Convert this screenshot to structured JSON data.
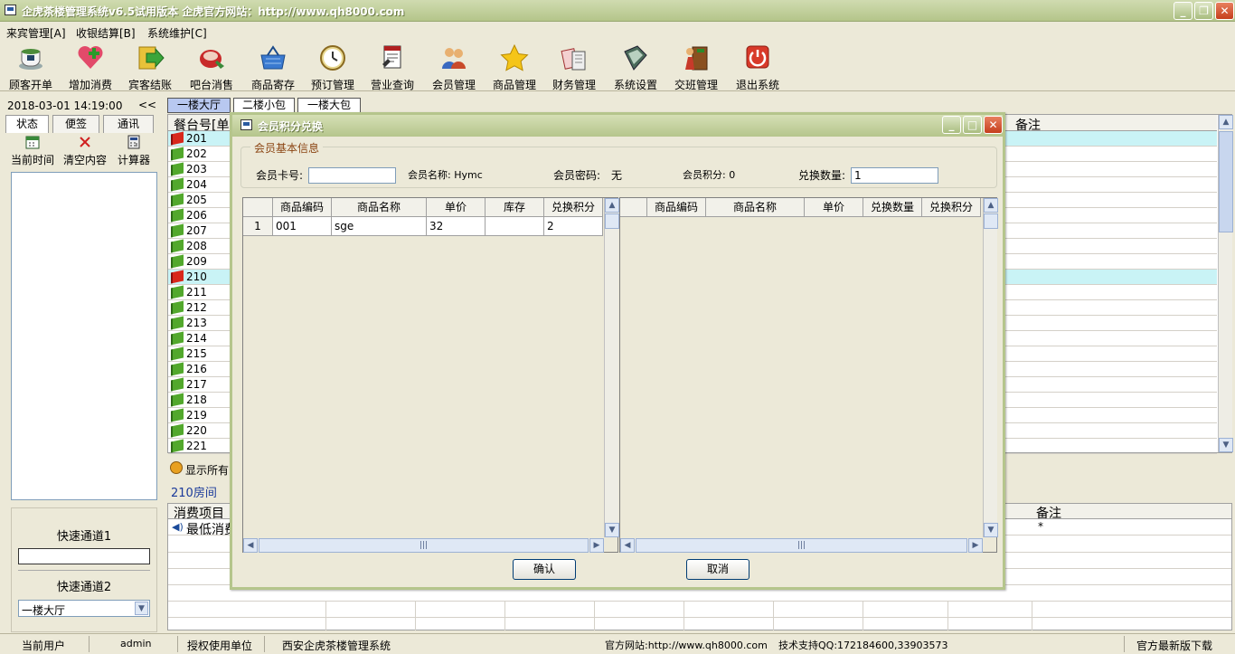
{
  "app": {
    "title": "企虎茶楼管理系统v6.5试用版本 企虎官方网站：http://www.qh8000.com"
  },
  "menu": [
    "来宾管理[A]",
    "收银结算[B]",
    "系统维护[C]"
  ],
  "toolbar": [
    {
      "label": "顾客开单",
      "icon": "teacup-icon"
    },
    {
      "label": "增加消费",
      "icon": "add-consumption-icon"
    },
    {
      "label": "宾客结账",
      "icon": "checkout-arrow-icon"
    },
    {
      "label": "吧台消售",
      "icon": "bar-sales-icon"
    },
    {
      "label": "商品寄存",
      "icon": "basket-icon"
    },
    {
      "label": "预订管理",
      "icon": "clock-icon"
    },
    {
      "label": "营业查询",
      "icon": "query-icon"
    },
    {
      "label": "会员管理",
      "icon": "members-icon"
    },
    {
      "label": "商品管理",
      "icon": "star-icon"
    },
    {
      "label": "财务管理",
      "icon": "finance-icon"
    },
    {
      "label": "系统设置",
      "icon": "settings-icon"
    },
    {
      "label": "交班管理",
      "icon": "shift-exit-icon"
    },
    {
      "label": "退出系统",
      "icon": "power-icon"
    }
  ],
  "sidebar": {
    "datetime": "2018-03-01  14:19:00",
    "collapse": "<<",
    "tabs": [
      "状态",
      "便签",
      "通讯"
    ],
    "tools": [
      "当前时间",
      "清空内容",
      "计算器"
    ],
    "quick1_label": "快速通道1",
    "quick2_label": "快速通道2",
    "quick2_value": "一楼大厅"
  },
  "room_tabs": [
    "一楼大厅",
    "二楼小包",
    "一楼大包"
  ],
  "room_grid": {
    "col_header": "餐台号[单",
    "note_header": "备注",
    "rows": [
      {
        "num": "201",
        "status": "red"
      },
      {
        "num": "202",
        "status": "green"
      },
      {
        "num": "203",
        "status": "green"
      },
      {
        "num": "204",
        "status": "green"
      },
      {
        "num": "205",
        "status": "green"
      },
      {
        "num": "206",
        "status": "green"
      },
      {
        "num": "207",
        "status": "green"
      },
      {
        "num": "208",
        "status": "green"
      },
      {
        "num": "209",
        "status": "green"
      },
      {
        "num": "210",
        "status": "red"
      },
      {
        "num": "211",
        "status": "green"
      },
      {
        "num": "212",
        "status": "green"
      },
      {
        "num": "213",
        "status": "green"
      },
      {
        "num": "214",
        "status": "green"
      },
      {
        "num": "215",
        "status": "green"
      },
      {
        "num": "216",
        "status": "green"
      },
      {
        "num": "217",
        "status": "green"
      },
      {
        "num": "218",
        "status": "green"
      },
      {
        "num": "219",
        "status": "green"
      },
      {
        "num": "220",
        "status": "green"
      },
      {
        "num": "221",
        "status": "green"
      }
    ]
  },
  "show_all_label": "显示所有",
  "room_label": "210房间",
  "consumption": {
    "header": "消费项目",
    "note_header": "备注",
    "row_item": "最低消费",
    "row_note": "*"
  },
  "dialog": {
    "title": "会员积分兑换",
    "section": "会员基本信息",
    "card_label": "会员卡号:",
    "card_value": "",
    "name_label": "会员名称: Hymc",
    "password_label": "会员密码:",
    "password_value": "无",
    "points_label": "会员积分: 0",
    "qty_label": "兑换数量:",
    "qty_value": "1",
    "left_headers": [
      "商品编码",
      "商品名称",
      "单价",
      "库存",
      "兑换积分"
    ],
    "left_rows": [
      [
        "1",
        "001",
        "sge",
        "32",
        "",
        "2"
      ]
    ],
    "right_headers": [
      "商品编码",
      "商品名称",
      "单价",
      "兑换数量",
      "兑换积分"
    ],
    "confirm": "确认",
    "cancel": "取消"
  },
  "status": {
    "user_label": "当前用户",
    "user": "admin",
    "auth_label": "授权使用单位",
    "company": "西安企虎茶楼管理系统",
    "website": "官方网站:http://www.qh8000.com",
    "support": "技术支持QQ:172184600,33903573",
    "download": "官方最新版下载"
  }
}
